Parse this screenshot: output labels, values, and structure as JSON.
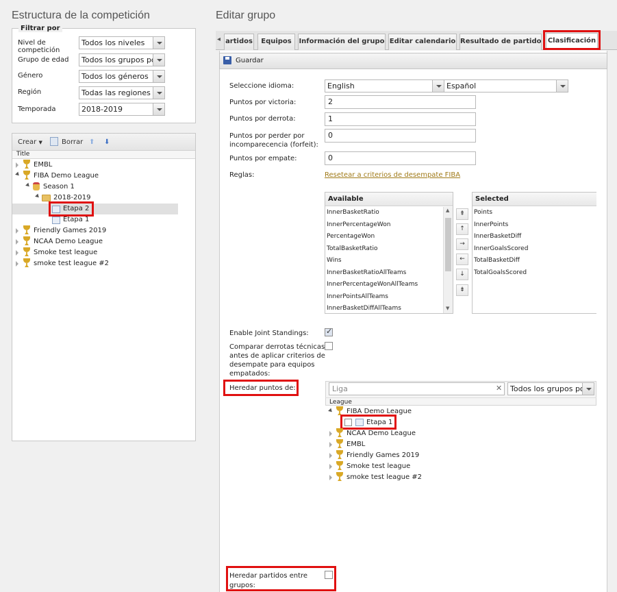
{
  "left": {
    "title": "Estructura de la competición",
    "filter": {
      "legend": "Filtrar por",
      "rows": [
        {
          "label": "Nivel de competición",
          "value": "Todos los niveles"
        },
        {
          "label": "Grupo de edad",
          "value": "Todos los grupos por"
        },
        {
          "label": "Género",
          "value": "Todos los géneros"
        },
        {
          "label": "Región",
          "value": "Todas las regiones"
        },
        {
          "label": "Temporada",
          "value": "2018-2019"
        }
      ]
    },
    "toolbar": {
      "create": "Crear",
      "delete": "Borrar"
    },
    "tree": {
      "header": "Title",
      "items": [
        "EMBL",
        "FIBA Demo League",
        "Season 1",
        "2018-2019",
        "Etapa 2",
        "Etapa 1",
        "Friendly Games 2019",
        "NCAA Demo League",
        "Smoke test league",
        "smoke test league #2"
      ]
    }
  },
  "right": {
    "title": "Editar grupo",
    "tabs": [
      "artidos",
      "Equipos",
      "Información del grupo",
      "Editar calendario",
      "Resultado de partido",
      "Clasificación"
    ],
    "save": "Guardar",
    "form": {
      "language_label": "Seleccione idioma:",
      "language_value_1": "English",
      "language_value_2": "Español",
      "win_label": "Puntos por victoria:",
      "win_value": "2",
      "loss_label": "Puntos por derrota:",
      "loss_value": "1",
      "forfeit_label_1": "Puntos por perder por",
      "forfeit_label_2": "incomparecencia (forfeit):",
      "forfeit_value": "0",
      "draw_label": "Puntos por empate:",
      "draw_value": "0",
      "rules_label": "Reglas:",
      "reset_link": "Resetear a criterios de desempate FIBA"
    },
    "available": {
      "header": "Available",
      "items": [
        "InnerBasketRatio",
        "InnerPercentageWon",
        "PercentageWon",
        "TotalBasketRatio",
        "Wins",
        "InnerBasketRatioAllTeams",
        "InnerPercentageWonAllTeams",
        "InnerPointsAllTeams",
        "InnerBasketDiffAllTeams"
      ]
    },
    "selected": {
      "header": "Selected",
      "items": [
        "Points",
        "InnerPoints",
        "InnerBasketDiff",
        "InnerGoalsScored",
        "TotalBasketDiff",
        "TotalGoalsScored"
      ]
    },
    "move_buttons": [
      "⇞",
      "↑",
      "→",
      "←",
      "↓",
      "⇟"
    ],
    "joint_label": "Enable Joint Standings:",
    "compare_label": [
      "Comparar derrotas técnicas",
      "antes de aplicar criterios de",
      "desempate para equipos",
      "empatados:"
    ],
    "inherit_label": "Heredar puntos de:",
    "inherit_search_placeholder": "Liga",
    "inherit_group_select": "Todos los grupos por e",
    "inherit_tree": {
      "header": "League",
      "items": [
        "FIBA Demo League",
        "Etapa 1",
        "NCAA Demo League",
        "EMBL",
        "Friendly Games 2019",
        "Smoke test league",
        "smoke test league #2"
      ]
    },
    "inherit_matches_label": [
      "Heredar partidos entre",
      "grupos:"
    ]
  }
}
